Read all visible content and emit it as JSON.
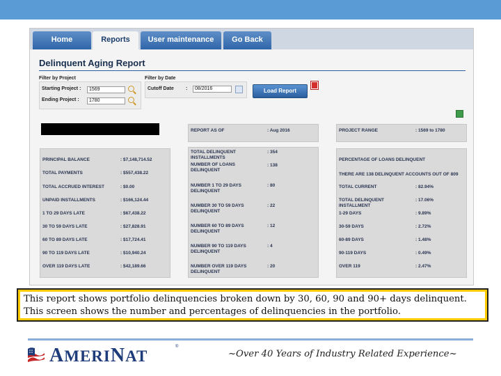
{
  "nav": {
    "tabs": [
      {
        "label": "Home"
      },
      {
        "label": "Reports"
      },
      {
        "label": "User maintenance"
      },
      {
        "label": "Go Back"
      }
    ],
    "active": "Reports"
  },
  "report": {
    "title": "Delinquent Aging Report",
    "filter_project": {
      "heading": "Filter by Project",
      "start_label": "Starting Project :",
      "start_value": "1569",
      "end_label": "Ending Project  :",
      "end_value": "1780"
    },
    "filter_date": {
      "heading": "Filter by Date",
      "cutoff_label": "Cutoff Date",
      "cutoff_sep": ":",
      "cutoff_value": "08/2016"
    },
    "load_button": "Load Report",
    "report_as_of": {
      "label": "REPORT AS OF",
      "value": ": Aug 2016"
    },
    "project_range": {
      "label": "PROJECT RANGE",
      "value": ": 1569 to 1780"
    },
    "balances": [
      {
        "label": "PRINCIPAL BALANCE",
        "value": ": $7,148,714.52"
      },
      {
        "label": "TOTAL PAYMENTS",
        "value": ": $557,438.22"
      },
      {
        "label": "TOTAL ACCRUED INTEREST",
        "value": ": $0.00"
      },
      {
        "label": "UNPAID INSTALLMENTS",
        "value": ": $166,124.44"
      },
      {
        "label": "1 TO 29 DAYS LATE",
        "value": ": $67,438.22"
      },
      {
        "label": "30 TO 59 DAYS LATE",
        "value": ": $27,828.91"
      },
      {
        "label": "60 TO 89 DAYS LATE",
        "value": ": $17,724.41"
      },
      {
        "label": "90 TO 119 DAYS LATE",
        "value": ": $10,940.24"
      },
      {
        "label": "OVER 119 DAYS LATE",
        "value": ": $42,189.66"
      }
    ],
    "counts": [
      {
        "label": "TOTAL DELINQUENT INSTALLMENTS",
        "value": ": 354"
      },
      {
        "label": "NUMBER OF LOANS DELINQUENT",
        "value": ": 138"
      },
      {
        "label": "NUMBER 1 TO 29 DAYS DELINQUENT",
        "value": ": 80"
      },
      {
        "label": "NUMBER 30 TO 59 DAYS DELINQUENT",
        "value": ": 22"
      },
      {
        "label": "NUMBER 60 TO 89 DAYS DELINQUENT",
        "value": ": 12"
      },
      {
        "label": "NUMBER 90 TO 119 DAYS DELINQUENT",
        "value": ": 4"
      },
      {
        "label": "NUMBER OVER 119 DAYS DELINQUENT",
        "value": ": 20"
      }
    ],
    "percentages": {
      "heading": "PERCENTAGE OF LOANS DELINQUENT",
      "note": "THERE ARE 138 DELINQUENT ACCOUNTS OUT OF 809",
      "rows": [
        {
          "label": "TOTAL CURRENT",
          "value": ": 82.94%"
        },
        {
          "label": "TOTAL DELINQUENT INSTALLMENT",
          "value": ": 17.06%"
        },
        {
          "label": "1-29 DAYS",
          "value": ": 9.89%"
        },
        {
          "label": "30-59 DAYS",
          "value": ": 2.72%"
        },
        {
          "label": "60-89 DAYS",
          "value": ": 1.48%"
        },
        {
          "label": "90-119 DAYS",
          "value": ": 0.49%"
        },
        {
          "label": "OVER 119",
          "value": ": 2.47%"
        }
      ]
    }
  },
  "caption": "This report shows portfolio delinquencies broken down by 30, 60, 90 and 90+ days delinquent.  This screen shows the number and percentages of delinquencies in the portfolio.",
  "footer": {
    "logo_text_big_a": "A",
    "logo_text_meri": "MERI",
    "logo_text_big_n": "N",
    "logo_text_at": "AT",
    "logo_tm": "®",
    "tagline": "~Over 40 Years of Industry Related Experience~"
  },
  "colors": {
    "topbar": "#5b9bd5",
    "tab_blue": "#2f65a8",
    "caption_border": "#ffcc00",
    "logo_blue": "#1f3c7a"
  }
}
